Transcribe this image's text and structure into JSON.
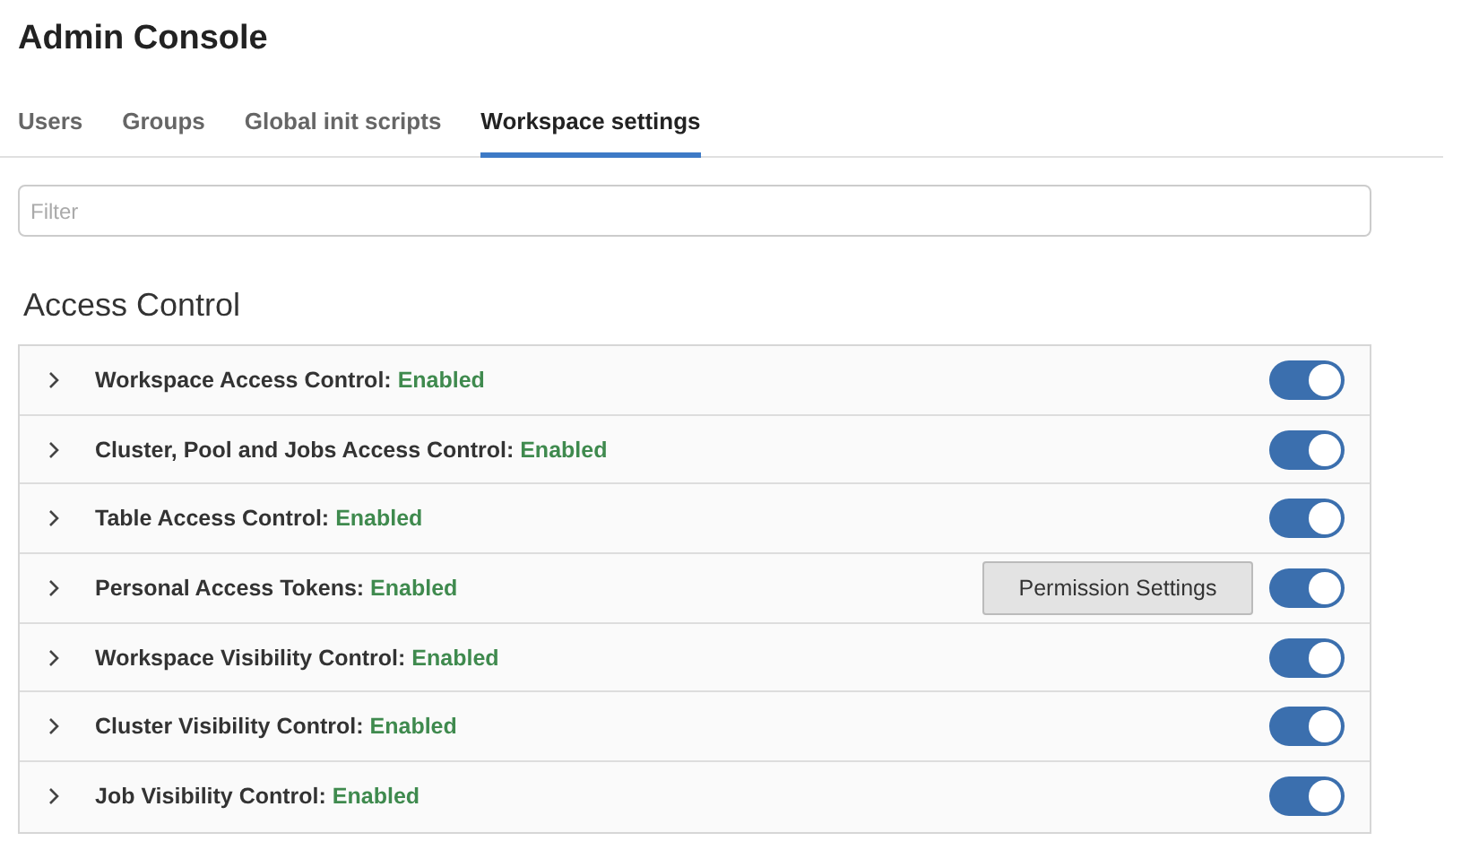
{
  "page": {
    "title": "Admin Console"
  },
  "tabs": [
    {
      "label": "Users",
      "selected": false
    },
    {
      "label": "Groups",
      "selected": false
    },
    {
      "label": "Global init scripts",
      "selected": false
    },
    {
      "label": "Workspace settings",
      "selected": true
    }
  ],
  "filter": {
    "placeholder": "Filter"
  },
  "section": {
    "title": "Access Control",
    "settings": [
      {
        "name": "Workspace Access Control:",
        "status": "Enabled",
        "expanded": false,
        "on": true
      },
      {
        "name": "Cluster, Pool and Jobs Access Control:",
        "status": "Enabled",
        "expanded": false,
        "on": true
      },
      {
        "name": "Table Access Control:",
        "status": "Enabled",
        "expanded": false,
        "on": true
      },
      {
        "name": "Personal Access Tokens:",
        "status": "Enabled",
        "expanded": false,
        "on": true,
        "button": "Permission Settings"
      },
      {
        "name": "Workspace Visibility Control:",
        "status": "Enabled",
        "expanded": false,
        "on": true
      },
      {
        "name": "Cluster Visibility Control:",
        "status": "Enabled",
        "expanded": false,
        "on": true
      },
      {
        "name": "Job Visibility Control:",
        "status": "Enabled",
        "expanded": false,
        "on": true
      }
    ]
  }
}
